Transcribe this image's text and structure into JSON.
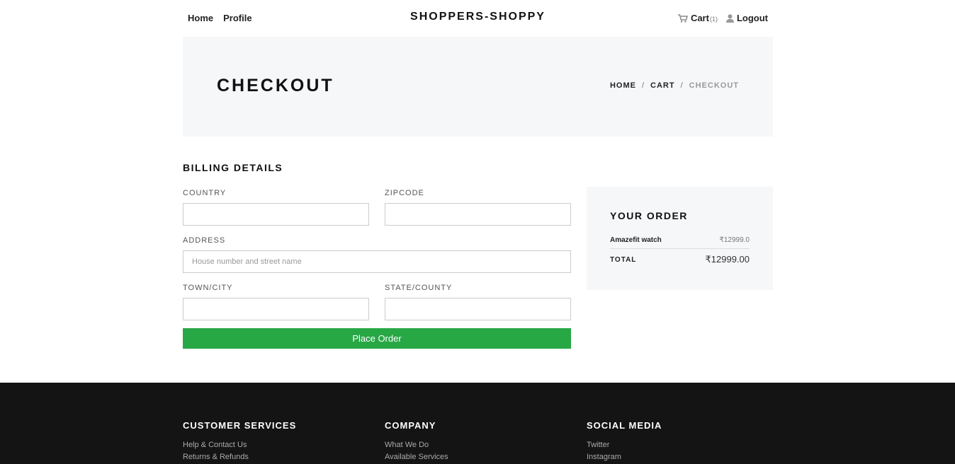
{
  "nav": {
    "left_links": [
      "Home",
      "Profile"
    ],
    "brand": "SHOPPERS-SHOPPY",
    "cart_label": "Cart",
    "cart_count": "(1)",
    "logout_label": "Logout"
  },
  "hero": {
    "title": "CHECKOUT",
    "breadcrumb": [
      "HOME",
      "CART",
      "CHECKOUT"
    ],
    "separator": "/"
  },
  "billing": {
    "title": "BILLING DETAILS",
    "country_label": "COUNTRY",
    "country_value": "",
    "zipcode_label": "ZIPCODE",
    "zipcode_value": "",
    "address_label": "ADDRESS",
    "address_placeholder": "House number and street name",
    "town_label": "TOWN/CITY",
    "town_value": "",
    "state_label": "STATE/COUNTY",
    "state_value": "",
    "submit_label": "Place Order",
    "submit_color": "#28a745"
  },
  "order": {
    "title": "YOUR ORDER",
    "items": [
      {
        "name": "Amazefit watch",
        "price": "₹12999.0"
      }
    ],
    "total_label": "TOTAL",
    "total_value": "₹12999.00"
  },
  "footer": {
    "columns": [
      {
        "title": "CUSTOMER SERVICES",
        "links": [
          "Help & Contact Us",
          "Returns & Refunds"
        ]
      },
      {
        "title": "COMPANY",
        "links": [
          "What We Do",
          "Available Services"
        ]
      },
      {
        "title": "SOCIAL MEDIA",
        "links": [
          "Twitter",
          "Instagram"
        ]
      }
    ]
  },
  "icons": {
    "cart": "cart-icon",
    "logout": "user-icon"
  }
}
